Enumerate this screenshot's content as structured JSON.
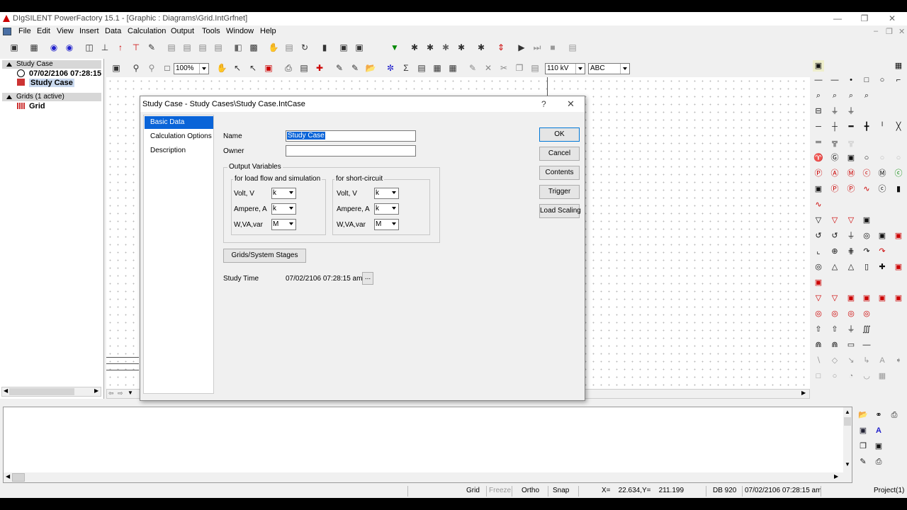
{
  "window": {
    "title": "DIgSILENT PowerFactory 15.1 - [Graphic : Diagrams\\Grid.IntGrfnet]"
  },
  "menu": [
    "File",
    "Edit",
    "View",
    "Insert",
    "Data",
    "Calculation",
    "Output",
    "Tools",
    "Window",
    "Help"
  ],
  "toolbar2": {
    "zoom": "100%",
    "voltage": "110 kV",
    "text_style": "ABC"
  },
  "tree": {
    "section1": "Study Case",
    "item1": "07/02/2106 07:28:15",
    "item2": "Study Case",
    "section2": "Grids (1 active)",
    "item3": "Grid"
  },
  "dialog": {
    "title": "Study Case - Study Cases\\Study Case.IntCase",
    "help": "?",
    "close": "✕",
    "tabs": [
      "Basic Data",
      "Calculation Options",
      "Description"
    ],
    "name_label": "Name",
    "name_value": "Study Case",
    "owner_label": "Owner",
    "owner_value": "",
    "output_group": "Output Variables",
    "lf_group": "for load flow and simulation",
    "sc_group": "for short-circuit",
    "lf_rows": [
      {
        "label": "Volt, V",
        "value": "k"
      },
      {
        "label": "Ampere, A",
        "value": "k"
      },
      {
        "label": "W,VA,var",
        "value": "M"
      }
    ],
    "sc_rows": [
      {
        "label": "Volt, V",
        "value": "k"
      },
      {
        "label": "Ampere, A",
        "value": "k"
      },
      {
        "label": "W,VA,var",
        "value": "M"
      }
    ],
    "grids_button": "Grids/System Stages",
    "study_time_label": "Study Time",
    "study_time_value": "07/02/2106 07:28:15 am",
    "ellipsis": "...",
    "buttons": [
      "OK",
      "Cancel",
      "Contents",
      "Trigger",
      "Load Scaling"
    ]
  },
  "status": {
    "grid": "Grid",
    "freeze": "Freeze",
    "ortho": "Ortho",
    "snap": "Snap",
    "coords": "X=    22.634,Y=    211.199",
    "db": "DB 920",
    "time": "07/02/2106 07:28:15 am",
    "project": "Project(1)"
  },
  "colors": {
    "selection": "#0a64d8",
    "app_icon": "#cc0000"
  }
}
